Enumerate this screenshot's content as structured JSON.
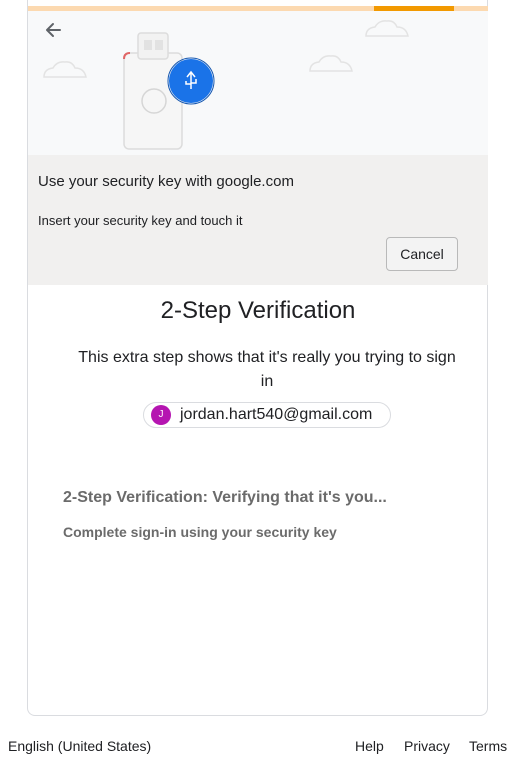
{
  "dialog": {
    "title": "Use your security key with google.com",
    "subtitle": "Insert your security key and touch it",
    "cancel_label": "Cancel"
  },
  "page": {
    "title": "2-Step Verification",
    "description": "This extra step shows that it's really you trying to sign in"
  },
  "account": {
    "avatar_letter": "J",
    "avatar_color": "#b515b1",
    "email": "jordan.hart540@gmail.com"
  },
  "status": {
    "title": "2-Step Verification: Verifying that it's you...",
    "subtitle": "Complete sign-in using your security key"
  },
  "footer": {
    "language": "English (United States)",
    "help": "Help",
    "privacy": "Privacy",
    "terms": "Terms"
  },
  "colors": {
    "accent_orange": "#f29900",
    "usb_blue": "#1a73e8"
  },
  "icons": [
    "back-arrow-icon",
    "security-key-icon",
    "usb-icon",
    "cloud-icon"
  ]
}
